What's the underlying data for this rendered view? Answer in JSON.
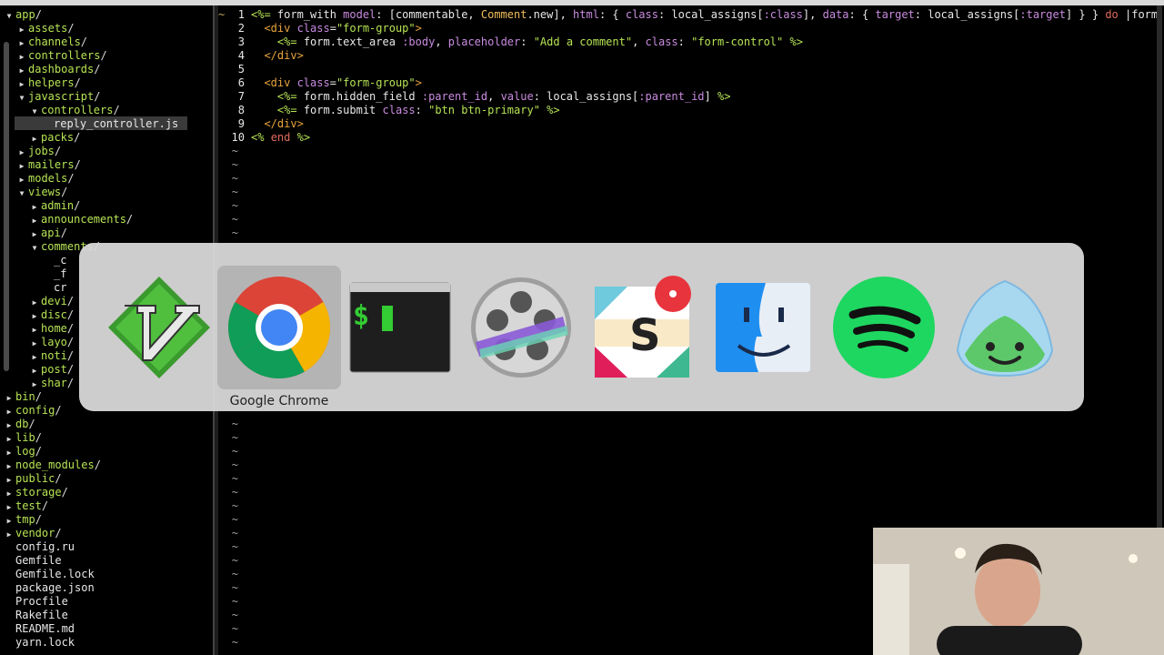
{
  "file_tree": {
    "rows": [
      {
        "indent": 1,
        "arrow": "open",
        "label": "app",
        "type": "dir"
      },
      {
        "indent": 2,
        "arrow": "closed",
        "label": "assets",
        "type": "dir"
      },
      {
        "indent": 2,
        "arrow": "closed",
        "label": "channels",
        "type": "dir"
      },
      {
        "indent": 2,
        "arrow": "closed",
        "label": "controllers",
        "type": "dir"
      },
      {
        "indent": 2,
        "arrow": "closed",
        "label": "dashboards",
        "type": "dir"
      },
      {
        "indent": 2,
        "arrow": "closed",
        "label": "helpers",
        "type": "dir"
      },
      {
        "indent": 2,
        "arrow": "open",
        "label": "javascript",
        "type": "dir"
      },
      {
        "indent": 3,
        "arrow": "open",
        "label": "controllers",
        "type": "dir"
      },
      {
        "indent": 4,
        "arrow": "",
        "label": "reply_controller.js",
        "type": "file"
      },
      {
        "indent": 3,
        "arrow": "closed",
        "label": "packs",
        "type": "dir"
      },
      {
        "indent": 2,
        "arrow": "closed",
        "label": "jobs",
        "type": "dir"
      },
      {
        "indent": 2,
        "arrow": "closed",
        "label": "mailers",
        "type": "dir"
      },
      {
        "indent": 2,
        "arrow": "closed",
        "label": "models",
        "type": "dir"
      },
      {
        "indent": 2,
        "arrow": "open",
        "label": "views",
        "type": "dir"
      },
      {
        "indent": 3,
        "arrow": "closed",
        "label": "admin",
        "type": "dir"
      },
      {
        "indent": 3,
        "arrow": "closed",
        "label": "announcements",
        "type": "dir"
      },
      {
        "indent": 3,
        "arrow": "closed",
        "label": "api",
        "type": "dir"
      },
      {
        "indent": 3,
        "arrow": "open",
        "label": "comments",
        "type": "dir"
      },
      {
        "indent": 4,
        "arrow": "",
        "label": "_c",
        "type": "file"
      },
      {
        "indent": 4,
        "arrow": "",
        "label": "_f",
        "type": "file"
      },
      {
        "indent": 4,
        "arrow": "",
        "label": "cr",
        "type": "file"
      },
      {
        "indent": 3,
        "arrow": "closed",
        "label": "devi",
        "type": "dir"
      },
      {
        "indent": 3,
        "arrow": "closed",
        "label": "disc",
        "type": "dir"
      },
      {
        "indent": 3,
        "arrow": "closed",
        "label": "home",
        "type": "dir"
      },
      {
        "indent": 3,
        "arrow": "closed",
        "label": "layo",
        "type": "dir"
      },
      {
        "indent": 3,
        "arrow": "closed",
        "label": "noti",
        "type": "dir"
      },
      {
        "indent": 3,
        "arrow": "closed",
        "label": "post",
        "type": "dir"
      },
      {
        "indent": 3,
        "arrow": "closed",
        "label": "shar",
        "type": "dir"
      },
      {
        "indent": 1,
        "arrow": "closed",
        "label": "bin",
        "type": "dir"
      },
      {
        "indent": 1,
        "arrow": "closed",
        "label": "config",
        "type": "dir"
      },
      {
        "indent": 1,
        "arrow": "closed",
        "label": "db",
        "type": "dir"
      },
      {
        "indent": 1,
        "arrow": "closed",
        "label": "lib",
        "type": "dir"
      },
      {
        "indent": 1,
        "arrow": "closed",
        "label": "log",
        "type": "dir"
      },
      {
        "indent": 1,
        "arrow": "closed",
        "label": "node_modules",
        "type": "dir"
      },
      {
        "indent": 1,
        "arrow": "closed",
        "label": "public",
        "type": "dir"
      },
      {
        "indent": 1,
        "arrow": "closed",
        "label": "storage",
        "type": "dir"
      },
      {
        "indent": 1,
        "arrow": "closed",
        "label": "test",
        "type": "dir"
      },
      {
        "indent": 1,
        "arrow": "closed",
        "label": "tmp",
        "type": "dir"
      },
      {
        "indent": 1,
        "arrow": "closed",
        "label": "vendor",
        "type": "dir"
      },
      {
        "indent": 1,
        "arrow": "",
        "label": "config.ru",
        "type": "file"
      },
      {
        "indent": 1,
        "arrow": "",
        "label": "Gemfile",
        "type": "file"
      },
      {
        "indent": 1,
        "arrow": "",
        "label": "Gemfile.lock",
        "type": "file"
      },
      {
        "indent": 1,
        "arrow": "",
        "label": "package.json",
        "type": "file"
      },
      {
        "indent": 1,
        "arrow": "",
        "label": "Procfile",
        "type": "file"
      },
      {
        "indent": 1,
        "arrow": "",
        "label": "Rakefile",
        "type": "file"
      },
      {
        "indent": 1,
        "arrow": "",
        "label": "README.md",
        "type": "file"
      },
      {
        "indent": 1,
        "arrow": "",
        "label": "yarn.lock",
        "type": "file"
      }
    ]
  },
  "editor": {
    "sign_marker": "~",
    "lines": [
      {
        "num": "1",
        "tokens": [
          [
            "erb",
            "<%= "
          ],
          [
            "txt",
            "form_with "
          ],
          [
            "sym",
            "model"
          ],
          [
            "txt",
            ": [commentable, "
          ],
          [
            "kw",
            "Comment"
          ],
          [
            "txt",
            ".new], "
          ],
          [
            "sym",
            "html"
          ],
          [
            "txt",
            ": { "
          ],
          [
            "sym",
            "class"
          ],
          [
            "txt",
            ": local_assigns["
          ],
          [
            "sym",
            ":class"
          ],
          [
            "txt",
            "], "
          ],
          [
            "sym",
            "data"
          ],
          [
            "txt",
            ": { "
          ],
          [
            "sym",
            "target"
          ],
          [
            "txt",
            ": local_assigns["
          ],
          [
            "sym",
            ":target"
          ],
          [
            "txt",
            "] } } "
          ],
          [
            "red",
            "do"
          ],
          [
            "txt",
            " |form|>"
          ]
        ]
      },
      {
        "num": "2",
        "tokens": [
          [
            "txt",
            "  "
          ],
          [
            "tag",
            "<div "
          ],
          [
            "sym",
            "class"
          ],
          [
            "txt",
            "="
          ],
          [
            "str",
            "\"form-group\""
          ],
          [
            "tag",
            ">"
          ]
        ]
      },
      {
        "num": "3",
        "tokens": [
          [
            "txt",
            "    "
          ],
          [
            "erb",
            "<%= "
          ],
          [
            "txt",
            "form.text_area "
          ],
          [
            "sym",
            ":body"
          ],
          [
            "txt",
            ", "
          ],
          [
            "sym",
            "placeholder"
          ],
          [
            "txt",
            ": "
          ],
          [
            "str",
            "\"Add a comment\""
          ],
          [
            "txt",
            ", "
          ],
          [
            "sym",
            "class"
          ],
          [
            "txt",
            ": "
          ],
          [
            "str",
            "\"form-control\""
          ],
          [
            "erb",
            " %>"
          ]
        ]
      },
      {
        "num": "4",
        "tokens": [
          [
            "txt",
            "  "
          ],
          [
            "tag",
            "</div>"
          ]
        ]
      },
      {
        "num": "5",
        "tokens": []
      },
      {
        "num": "6",
        "tokens": [
          [
            "txt",
            "  "
          ],
          [
            "tag",
            "<div "
          ],
          [
            "sym",
            "class"
          ],
          [
            "txt",
            "="
          ],
          [
            "str",
            "\"form-group\""
          ],
          [
            "tag",
            ">"
          ]
        ]
      },
      {
        "num": "7",
        "tokens": [
          [
            "txt",
            "    "
          ],
          [
            "erb",
            "<%= "
          ],
          [
            "txt",
            "form.hidden_field "
          ],
          [
            "sym",
            ":parent_id"
          ],
          [
            "txt",
            ", "
          ],
          [
            "sym",
            "value"
          ],
          [
            "txt",
            ": local_assigns["
          ],
          [
            "sym",
            ":parent_id"
          ],
          [
            "txt",
            "] "
          ],
          [
            "erb",
            "%>"
          ]
        ]
      },
      {
        "num": "8",
        "tokens": [
          [
            "txt",
            "    "
          ],
          [
            "erb",
            "<%= "
          ],
          [
            "txt",
            "form.submit "
          ],
          [
            "sym",
            "class"
          ],
          [
            "txt",
            ": "
          ],
          [
            "str",
            "\"btn btn-primary\""
          ],
          [
            "erb",
            " %>"
          ]
        ]
      },
      {
        "num": "9",
        "tokens": [
          [
            "txt",
            "  "
          ],
          [
            "tag",
            "</div>"
          ]
        ]
      },
      {
        "num": "10",
        "tokens": [
          [
            "erb",
            "<% "
          ],
          [
            "red",
            "end"
          ],
          [
            "erb",
            " %>"
          ]
        ]
      }
    ],
    "empty_marker": "~",
    "empty_lines_above": 7,
    "empty_lines_below": 17
  },
  "app_switcher": {
    "selected_label": "Google Chrome",
    "apps": [
      {
        "name": "vim-icon"
      },
      {
        "name": "google-chrome-icon"
      },
      {
        "name": "terminal-icon"
      },
      {
        "name": "video-app-icon"
      },
      {
        "name": "slack-icon"
      },
      {
        "name": "finder-icon"
      },
      {
        "name": "spotify-icon"
      },
      {
        "name": "basecamp-icon"
      }
    ],
    "terminal_prompt": "$"
  },
  "colors": {
    "dir": "#b6e354",
    "accent_red": "#e8343c",
    "spotify": "#1ed760",
    "vim": "#4ca83a"
  }
}
